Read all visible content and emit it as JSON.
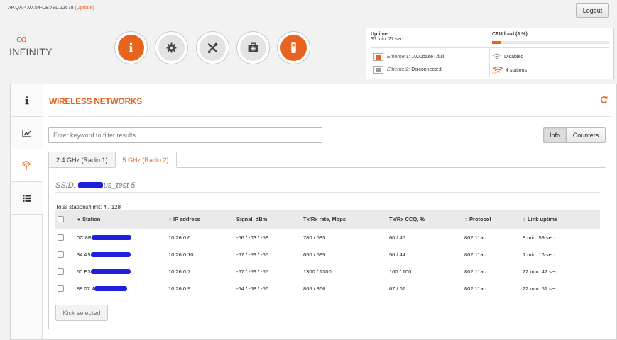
{
  "header": {
    "version": "AP.QA-4.v7.54-DEVEL.22578",
    "update_link": "(Update)",
    "logout": "Logout"
  },
  "logo": {
    "symbol": "∞",
    "text": "INFINITY"
  },
  "nav": [
    {
      "icon": "info-icon",
      "active": true
    },
    {
      "icon": "gear-icon",
      "active": false
    },
    {
      "icon": "tools-icon",
      "active": false
    },
    {
      "icon": "first-aid-kit-icon",
      "active": false
    },
    {
      "icon": "device-icon",
      "active": false
    }
  ],
  "status": {
    "uptime_label": "Uptime",
    "uptime_value": "35 min. 27 sec.",
    "cpu_label": "CPU load (8 %)",
    "cpu_percent": 8,
    "eth1_name": "Ethernet1:",
    "eth1_status": "1000baseT/full",
    "eth2_name": "Ethernet2:",
    "eth2_status": "Disconnected",
    "wlan1_status": "Disabled",
    "wlan2_badge": "5G",
    "wlan2_status": "4 stations"
  },
  "sidebar": [
    {
      "icon": "info-icon",
      "active": false
    },
    {
      "icon": "chart-icon",
      "active": false
    },
    {
      "icon": "wireless-icon",
      "active": true
    },
    {
      "icon": "list-icon",
      "active": false
    }
  ],
  "main": {
    "title": "WIRELESS NETWORKS",
    "filter_placeholder": "Enter keyword to filter results",
    "btn_info": "Info",
    "btn_counters": "Counters",
    "tabs": [
      "2.4 GHz (Radio 1)",
      "5 GHz (Radio 2)"
    ],
    "active_tab": 1,
    "ssid_prefix": "SSID:",
    "ssid_suffix": "us_test 5",
    "total": "Total stations/limit: 4 / 128",
    "kick_button": "Kick selected"
  },
  "table": {
    "columns": [
      "Station",
      "IP address",
      "Signal, dBm",
      "Tx/Rx rate, Mbps",
      "Tx/Rx CCQ, %",
      "Protocol",
      "Link uptime"
    ],
    "rows": [
      {
        "station": "0C:8B",
        "ip": "10.26.0.6",
        "signal": "-56 / -63 / -58",
        "rate": "780 / 585",
        "ccq": "60 / 45",
        "protocol": "802.11ac",
        "uptime": "8 min. 59 sec."
      },
      {
        "station": "34:A5",
        "ip": "10.26.0.10",
        "signal": "-57 / -59 / -65",
        "rate": "650 / 585",
        "ccq": "50 / 44",
        "protocol": "802.11ac",
        "uptime": "1 min. 16 sec."
      },
      {
        "station": "60:E3",
        "ip": "10.26.0.7",
        "signal": "-57 / -59 / -65",
        "rate": "1300 / 1300",
        "ccq": "100 / 100",
        "protocol": "802.11ac",
        "uptime": "22 min. 42 sec."
      },
      {
        "station": "88:07:4",
        "ip": "10.26.0.9",
        "signal": "-54 / -58 / -56",
        "rate": "866 / 866",
        "ccq": "67 / 67",
        "protocol": "802.11ac",
        "uptime": "22 min. 51 sec."
      }
    ]
  },
  "colors": {
    "accent": "#e8641e",
    "redaction": "#1f1fe0"
  }
}
